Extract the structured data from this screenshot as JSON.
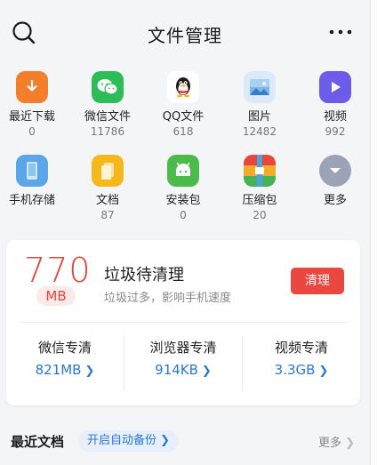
{
  "header": {
    "title": "文件管理",
    "search_icon": "search-icon",
    "more_icon": "more-horizontal-icon"
  },
  "categories": [
    {
      "label": "最近下载",
      "count": "0",
      "icon": "download-icon",
      "color": "#f37e2c"
    },
    {
      "label": "微信文件",
      "count": "11786",
      "icon": "wechat-icon",
      "color": "#2dbd56"
    },
    {
      "label": "QQ文件",
      "count": "618",
      "icon": "qq-penguin-icon",
      "color": "#ffffff"
    },
    {
      "label": "图片",
      "count": "12482",
      "icon": "image-icon",
      "color": "#dceaf7"
    },
    {
      "label": "视频",
      "count": "992",
      "icon": "play-icon",
      "color": "#6c5ce7"
    },
    {
      "label": "手机存储",
      "count": "",
      "icon": "phone-storage-icon",
      "color": "#5aa6e8"
    },
    {
      "label": "文档",
      "count": "87",
      "icon": "document-icon",
      "color": "#f5b81c"
    },
    {
      "label": "安装包",
      "count": "0",
      "icon": "android-icon",
      "color": "#4cbb4c"
    },
    {
      "label": "压缩包",
      "count": "20",
      "icon": "zip-archive-icon",
      "color": "#f2ac2a"
    },
    {
      "label": "更多",
      "count": "",
      "icon": "chevron-down-icon",
      "color": "#9aa4b6"
    }
  ],
  "junk": {
    "amount": "770",
    "unit": "MB",
    "title": "垃圾待清理",
    "subtitle": "垃圾过多，影响手机速度",
    "clean_label": "清理",
    "accent": "#e5453d"
  },
  "quick_clean": [
    {
      "label": "微信专清",
      "value": "821MB"
    },
    {
      "label": "浏览器专清",
      "value": "914KB"
    },
    {
      "label": "视频专清",
      "value": "3.3GB"
    }
  ],
  "recent": {
    "title": "最近文档",
    "backup_label": "开启自动备份",
    "more_label": "更多"
  },
  "link_color": "#2a78d6"
}
